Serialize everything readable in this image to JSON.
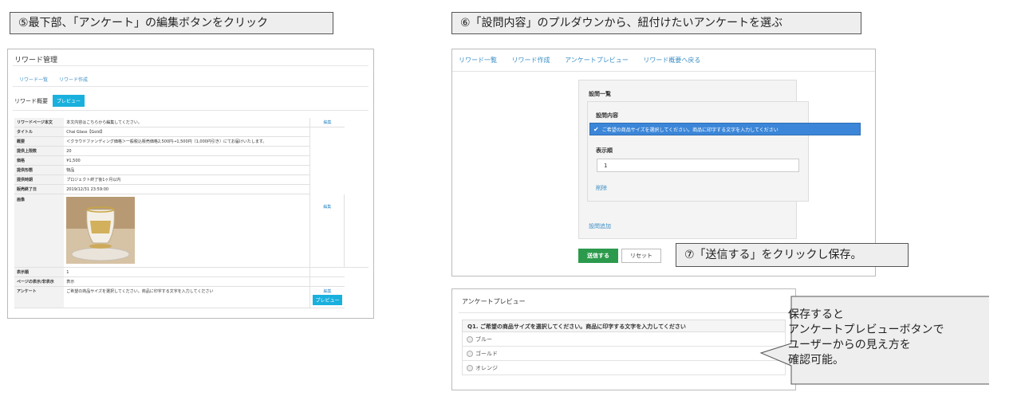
{
  "step5": {
    "label": "⑤最下部、「アンケート」の編集ボタンをクリック"
  },
  "step6": {
    "label": "⑥「設問内容」のプルダウンから、紐付けたいアンケートを選ぶ"
  },
  "step7": {
    "label": "⑦「送信する」をクリックし保存。"
  },
  "left_panel": {
    "title": "リワード管理",
    "tabs": [
      "リワード一覧",
      "リワード作成"
    ],
    "summary_label": "リワード概要",
    "preview_button": "プレビュー",
    "edit_link": "編集",
    "rows": [
      {
        "key": "リワードページ本文",
        "value": "本文内容はこちらから編集してください。"
      },
      {
        "key": "タイトル",
        "value": "Chai Glass【Gold】"
      },
      {
        "key": "概要",
        "value": "＜クラウドファンディング価格＞一般税込販売価格2,500円→1,500円（1,000円引き）にてお届けいたします。"
      },
      {
        "key": "提供上限数",
        "value": "20"
      },
      {
        "key": "価格",
        "value": "¥1,500"
      },
      {
        "key": "提供形態",
        "value": "物品"
      },
      {
        "key": "提供時期",
        "value": "プロジェクト終了後1ヶ月以内"
      },
      {
        "key": "販売終了日",
        "value": "2019/12/31 23:59:00"
      },
      {
        "key": "画像",
        "value": ""
      },
      {
        "key": "表示順",
        "value": "1"
      },
      {
        "key": "ページの表示/非表示",
        "value": "表示"
      },
      {
        "key": "アンケート",
        "value": "ご希望の商品サイズを選択してください。商品に印字する文字を入力してください"
      }
    ]
  },
  "right_panel": {
    "nav": [
      "リワード一覧",
      "リワード作成",
      "アンケートプレビュー",
      "リワード概要へ戻る"
    ],
    "section_title": "設問一覧",
    "question_label": "設問内容",
    "dropdown_value": "ご希望の商品サイズを選択してください。商品に印字する文字を入力してください",
    "order_label": "表示順",
    "order_value": "1",
    "delete_link": "削除",
    "add_link": "設問追加",
    "submit_button": "送信する",
    "reset_button": "リセット"
  },
  "preview_panel": {
    "title": "アンケートプレビュー",
    "question": "Q1. ご希望の商品サイズを選択してください。商品に印字する文字を入力してください",
    "options": [
      "ブルー",
      "ゴールド",
      "オレンジ"
    ]
  },
  "note": {
    "lines": [
      "保存すると",
      "アンケートプレビューボタンで",
      "ユーザーからの見え方を",
      "確認可能。"
    ]
  }
}
